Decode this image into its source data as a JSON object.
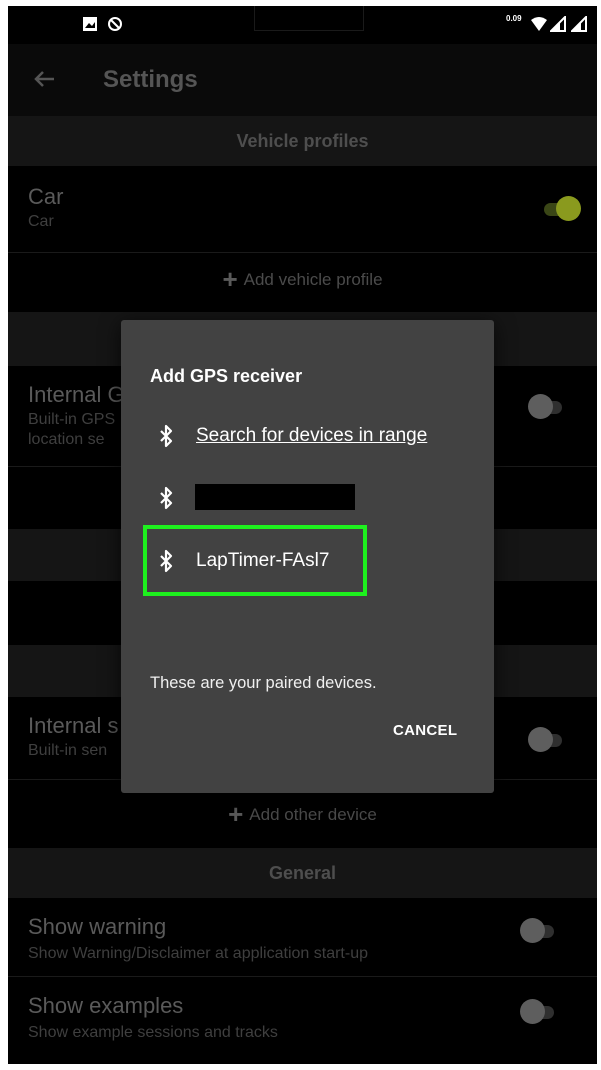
{
  "status_bar": {
    "left_icons": [
      "image-icon",
      "do-not-disturb-icon"
    ],
    "right_icons": [
      "data-speed-icon",
      "wifi-icon",
      "signal-icon",
      "signal-icon"
    ],
    "speed_text": "0.09"
  },
  "app_bar": {
    "title": "Settings",
    "back_icon": "arrow-back-icon"
  },
  "sections": {
    "vehicle_profiles": {
      "header": "Vehicle profiles",
      "car_title": "Car",
      "car_subtitle": "Car",
      "car_toggle_on": true,
      "add_label": "Add vehicle profile"
    },
    "gps": {
      "internal_title": "Internal G",
      "internal_sub1": "Built-in GPS",
      "internal_sub2": "location se"
    },
    "sensors": {
      "internal_title": "Internal s",
      "internal_sub": "Built-in sen"
    },
    "other": {
      "add_label": "Add other device"
    },
    "general": {
      "header": "General",
      "warning_title": "Show warning",
      "warning_sub": "Show Warning/Disclaimer at application start-up",
      "examples_title": "Show examples",
      "examples_sub": "Show example sessions and tracks"
    }
  },
  "dialog": {
    "title": "Add GPS receiver",
    "items": [
      {
        "label": "Search for devices in range",
        "icon": "bluetooth-icon"
      },
      {
        "label": "",
        "icon": "bluetooth-icon"
      },
      {
        "label": "LapTimer-FAsl7",
        "icon": "bluetooth-icon"
      }
    ],
    "message": "These are your paired devices.",
    "cancel_label": "CANCEL",
    "highlight_color": "#1ef01e"
  },
  "colors": {
    "accent": "#8a9a1e",
    "dialog_bg": "#424242"
  }
}
